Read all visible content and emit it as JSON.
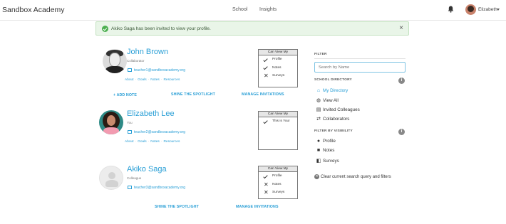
{
  "header": {
    "brand": "Sandbox Academy",
    "nav": [
      "School",
      "Insights"
    ],
    "user_name": "Elizabeth"
  },
  "alert": {
    "message": "Akiko Saga has been invited to view your profile.",
    "close": "×"
  },
  "profiles": [
    {
      "name": "John Brown",
      "role": "Collaborator",
      "email": "teacher1@sandboxacademy.org",
      "links": [
        "About",
        "Goals",
        "Notes",
        "Resources"
      ],
      "can_view_title": "Can View My",
      "can_view": [
        {
          "label": "Profile",
          "allowed": true
        },
        {
          "label": "Notes",
          "allowed": true
        },
        {
          "label": "Surveys",
          "allowed": false
        }
      ],
      "actions": [
        "+ ADD NOTE",
        "SHINE THE SPOTLIGHT",
        "MANAGE INVITATIONS"
      ]
    },
    {
      "name": "Elizabeth Lee",
      "role": "You",
      "email": "teacher2@sandboxacademy.org",
      "links": [
        "About",
        "Goals",
        "Notes",
        "Resources"
      ],
      "can_view_title": "Can View My",
      "can_view": [
        {
          "label": "This is You!",
          "allowed": true
        }
      ]
    },
    {
      "name": "Akiko Saga",
      "role": "Colleague",
      "email": "teacher3@sandboxacademy.org",
      "can_view_title": "Can View My",
      "can_view": [
        {
          "label": "Profile",
          "allowed": true
        },
        {
          "label": "Notes",
          "allowed": false
        },
        {
          "label": "Surveys",
          "allowed": false
        }
      ],
      "actions": [
        "SHINE THE SPOTLIGHT",
        "MANAGE INVITATIONS"
      ]
    }
  ],
  "filter": {
    "heading": "FILTER",
    "search_placeholder": "Search by Name",
    "directory_heading": "SCHOOL DIRECTORY",
    "directory_items": [
      {
        "label": "My Directory",
        "icon": "home-icon",
        "active": true
      },
      {
        "label": "View All",
        "icon": "globe-icon",
        "active": false
      },
      {
        "label": "Invited Colleagues",
        "icon": "invite-icon",
        "active": false
      },
      {
        "label": "Collaborators",
        "icon": "swap-icon",
        "active": false
      }
    ],
    "visibility_heading": "FILTER BY VISIBILITY",
    "visibility_items": [
      {
        "label": "Profile",
        "icon": "person-icon"
      },
      {
        "label": "Notes",
        "icon": "notes-icon"
      },
      {
        "label": "Surveys",
        "icon": "survey-icon"
      }
    ],
    "clear_label": "Clear current search query and filters"
  },
  "colors": {
    "accent": "#2a9fd6",
    "alert_bg": "#e9f5e8",
    "success": "#4caf50"
  }
}
